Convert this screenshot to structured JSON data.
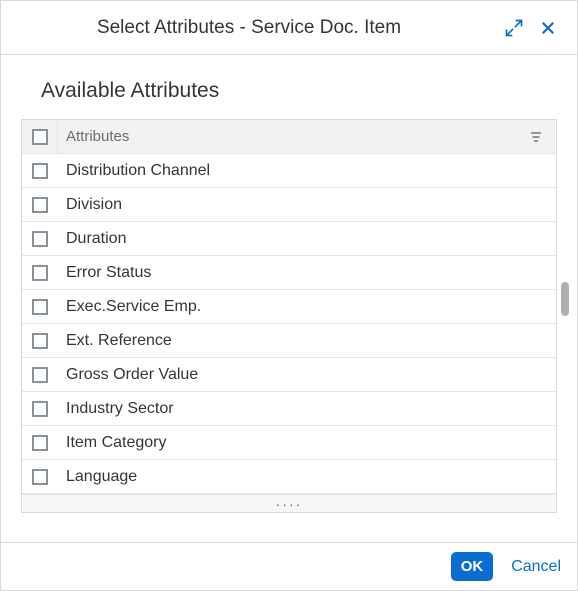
{
  "dialog": {
    "title": "Select Attributes - Service Doc. Item",
    "sectionTitle": "Available Attributes",
    "headerLabel": "Attributes",
    "moreIndicator": "····",
    "okLabel": "OK",
    "cancelLabel": "Cancel"
  },
  "attributes": [
    {
      "label": "Distribution Channel"
    },
    {
      "label": "Division"
    },
    {
      "label": "Duration"
    },
    {
      "label": "Error Status"
    },
    {
      "label": "Exec.Service Emp."
    },
    {
      "label": "Ext. Reference"
    },
    {
      "label": "Gross Order Value"
    },
    {
      "label": "Industry Sector"
    },
    {
      "label": "Item Category"
    },
    {
      "label": "Language"
    }
  ],
  "icons": {
    "expand": "expand-icon",
    "close": "close-icon",
    "sort": "sort-icon"
  },
  "colors": {
    "accent": "#0a6ed1",
    "text": "#32363a",
    "muted": "#6a6d70",
    "border": "#d9d9d9"
  }
}
